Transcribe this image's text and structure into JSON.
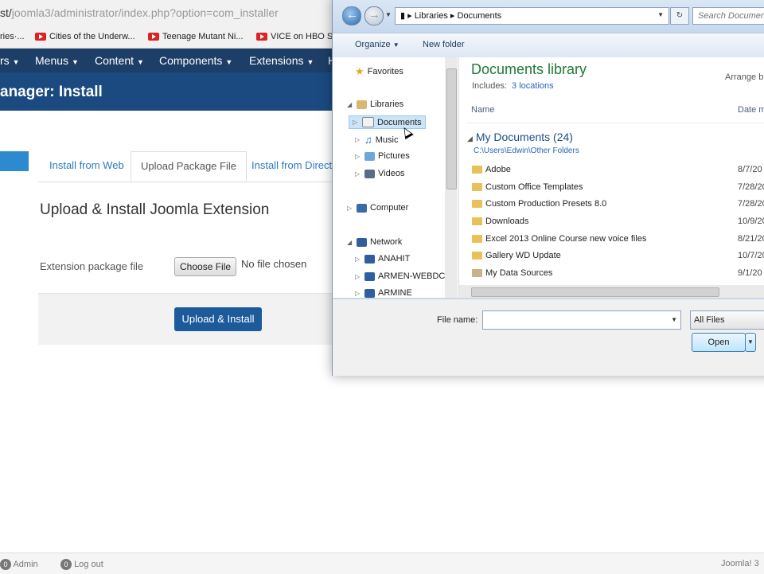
{
  "browser": {
    "url_prefix": "st/",
    "url_rest": "joomla3/administrator/index.php?option=com_installer",
    "bookmarks": [
      {
        "label": "ries·...",
        "icon": "none"
      },
      {
        "label": "Cities of the Underw...",
        "icon": "youtube-icon"
      },
      {
        "label": "Teenage Mutant Ni...",
        "icon": "youtube-icon"
      },
      {
        "label": "VICE on HBO S",
        "icon": "youtube-icon"
      }
    ]
  },
  "admin": {
    "menu": [
      "rs",
      "Menus",
      "Content",
      "Components",
      "Extensions",
      "H"
    ],
    "title": "anager: Install",
    "tabs": [
      "Install from Web",
      "Upload Package File",
      "Install from Directo"
    ],
    "active_tab": 1,
    "heading": "Upload & Install Joomla Extension",
    "package_label": "Extension package file",
    "choose_file": "Choose File",
    "no_file": "No file chosen",
    "upload_button": "Upload & Install",
    "footer": {
      "admin_count": "0",
      "admin_label": "Admin",
      "logout_count": "0",
      "logout_label": "Log out",
      "version": "Joomla! 3"
    }
  },
  "dialog": {
    "breadcrumb": [
      "Libraries",
      "Documents"
    ],
    "search_placeholder": "Search Documents",
    "organize": "Organize",
    "new_folder": "New folder",
    "nav": [
      {
        "label": "Favorites",
        "icon": "star-icon",
        "level": 0
      },
      {
        "label": "Libraries",
        "icon": "libraries-icon",
        "level": 0
      },
      {
        "label": "Documents",
        "icon": "documents-icon",
        "level": 1,
        "selected": true
      },
      {
        "label": "Music",
        "icon": "music-icon",
        "level": 1
      },
      {
        "label": "Pictures",
        "icon": "pictures-icon",
        "level": 1
      },
      {
        "label": "Videos",
        "icon": "videos-icon",
        "level": 1
      },
      {
        "label": "Computer",
        "icon": "computer-icon",
        "level": 0
      },
      {
        "label": "Network",
        "icon": "network-icon",
        "level": 0
      },
      {
        "label": "ANAHIT",
        "icon": "network-pc-icon",
        "level": 1
      },
      {
        "label": "ARMEN-WEBDC",
        "icon": "network-pc-icon",
        "level": 1
      },
      {
        "label": "ARMINE",
        "icon": "network-pc-icon",
        "level": 1
      }
    ],
    "library_title": "Documents library",
    "includes_label": "Includes:",
    "includes_link": "3 locations",
    "arrange_by": "Arrange b",
    "col_name": "Name",
    "col_date": "Date m",
    "group_label": "My Documents (24)",
    "group_path": "C:\\Users\\Edwin\\Other Folders",
    "files": [
      {
        "name": "Adobe",
        "date": "8/7/20"
      },
      {
        "name": "Custom Office Templates",
        "date": "7/28/20"
      },
      {
        "name": "Custom Production Presets 8.0",
        "date": "7/28/20"
      },
      {
        "name": "Downloads",
        "date": "10/9/20"
      },
      {
        "name": "Excel 2013 Online Course new voice files",
        "date": "8/21/20"
      },
      {
        "name": "Gallery WD Update",
        "date": "10/7/20"
      },
      {
        "name": "My Data Sources",
        "date": "9/1/20"
      }
    ],
    "file_name_label": "File name:",
    "file_name_value": "",
    "filter": "All Files",
    "open_button": "Open"
  }
}
